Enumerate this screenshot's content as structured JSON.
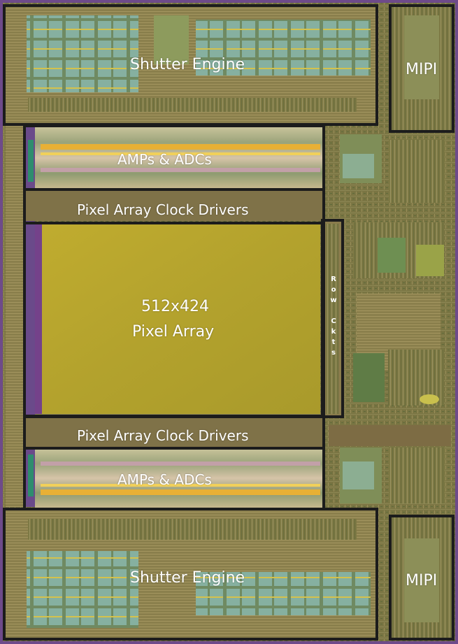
{
  "image": {
    "kind": "die-photo",
    "colors": {
      "substrate": "#7c7a45",
      "pixel_array": "#b4a62e",
      "metal_gold": "#c9a53a",
      "block_outline": "#1c1c1c",
      "purple_ring": "#6e4a8a",
      "label": "#ffffff"
    }
  },
  "labels": {
    "shutter_top": "Shutter Engine",
    "mipi_top": "MIPI",
    "amps_top": "AMPs & ADCs",
    "clock_top": "Pixel Array Clock Drivers",
    "pixel_array_line1": "512x424",
    "pixel_array_line2": "Pixel Array",
    "row_ckts": [
      "R",
      "o",
      "w",
      "",
      "C",
      "k",
      "t",
      "s"
    ],
    "clock_bottom": "Pixel Array Clock Drivers",
    "amps_bottom": "AMPs & ADCs",
    "shutter_bottom": "Shutter Engine",
    "mipi_bottom": "MIPI"
  }
}
